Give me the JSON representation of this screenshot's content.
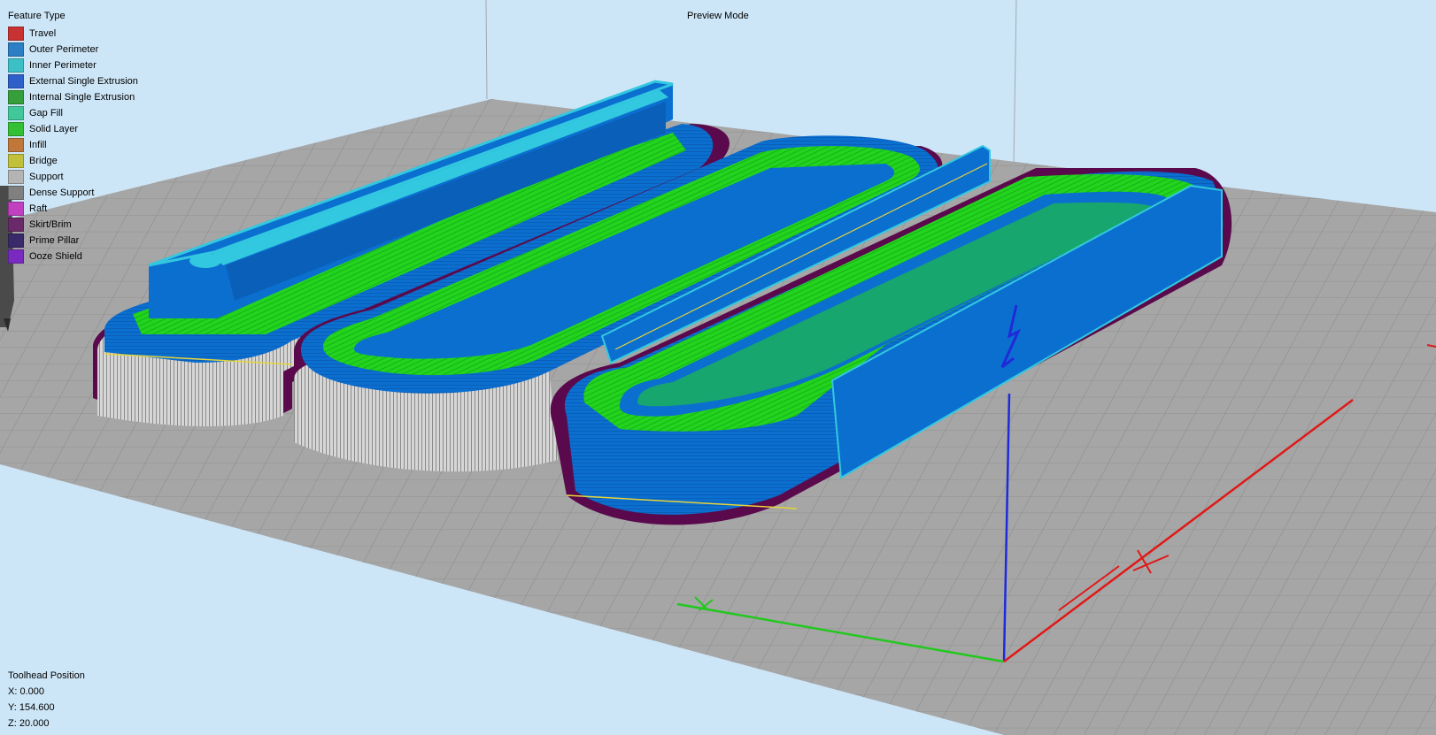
{
  "view": {
    "mode_label": "Preview Mode"
  },
  "legend": {
    "title": "Feature Type",
    "items": [
      {
        "label": "Travel",
        "color": "#c83232"
      },
      {
        "label": "Outer Perimeter",
        "color": "#2c7fc4"
      },
      {
        "label": "Inner Perimeter",
        "color": "#3cc0c8"
      },
      {
        "label": "External Single Extrusion",
        "color": "#2f5fc8"
      },
      {
        "label": "Internal Single Extrusion",
        "color": "#35a03a"
      },
      {
        "label": "Gap Fill",
        "color": "#40c89a"
      },
      {
        "label": "Solid Layer",
        "color": "#34c034"
      },
      {
        "label": "Infill",
        "color": "#c0783a"
      },
      {
        "label": "Bridge",
        "color": "#c0c03a"
      },
      {
        "label": "Support",
        "color": "#b4b4b4"
      },
      {
        "label": "Dense Support",
        "color": "#808080"
      },
      {
        "label": "Raft",
        "color": "#c040c0"
      },
      {
        "label": "Skirt/Brim",
        "color": "#6a2a6a"
      },
      {
        "label": "Prime Pillar",
        "color": "#3a2a6a"
      },
      {
        "label": "Ooze Shield",
        "color": "#7a2ac0"
      }
    ]
  },
  "toolhead": {
    "title": "Toolhead Position",
    "x": "X: 0.000",
    "y": "Y: 154.600",
    "z": "Z: 20.000"
  },
  "scene_colors": {
    "background": "#cde6f7",
    "bed": "#a6a6a6",
    "outer_perimeter": "#0b6fd0",
    "inner_perimeter": "#32c8e0",
    "solid_layer": "#22d41e",
    "support": "#bdbdbd",
    "skirt_brim": "#5a0a4c"
  }
}
